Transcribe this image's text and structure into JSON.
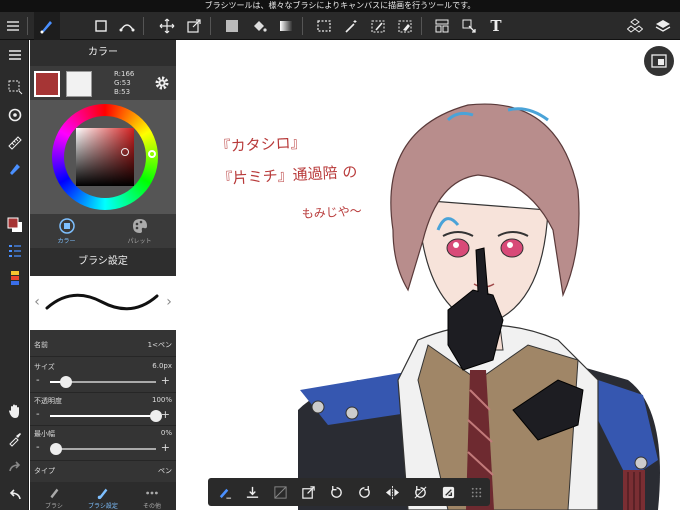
{
  "tipbar": {
    "text": "ブラシツールは、様々なブラシによりキャンバスに描画を行うツールです。"
  },
  "toolbar": {
    "icons": [
      "menu-icon",
      "brush-tool-icon",
      "shape-tool-icon",
      "curve-tool-icon",
      "move-tool-icon",
      "transform-tool-icon",
      "fill-color-icon",
      "bucket-icon",
      "gradient-icon",
      "select-rect-icon",
      "magic-wand-icon",
      "select-pen-icon",
      "select-eraser-icon",
      "layout-icon",
      "operation-icon",
      "text-tool-icon",
      "materials-icon",
      "layers-icon"
    ],
    "text_tool_label": "T"
  },
  "leftstrip": {
    "icons": [
      "layer-menu-icon",
      "selection-icon",
      "snap-icon",
      "ruler-icon",
      "eyedropper-pen-icon",
      "color-toggle-icon",
      "brush-list-icon",
      "palette-list-icon",
      "hand-icon",
      "dropper-icon",
      "redo-icon",
      "undo-icon"
    ]
  },
  "color_panel": {
    "title": "カラー",
    "main_color": "#a63535",
    "sub_color": "#f2f2f2",
    "r": "R:166",
    "g": "G:53",
    "b": "B:53",
    "tabs": [
      {
        "label": "カラー",
        "active": true
      },
      {
        "label": "パレット",
        "active": false
      }
    ]
  },
  "brush_panel": {
    "title": "ブラシ設定",
    "name_label": "名前",
    "name_value": "1<ペン",
    "size_label": "サイズ",
    "size_value": "6.0px",
    "size_level": 0.15,
    "opacity_label": "不透明度",
    "opacity_value": "100%",
    "opacity_level": 1.0,
    "min_width_label": "最小幅",
    "min_width_value": "0%",
    "min_width_level": 0.0,
    "type_label": "タイプ",
    "type_value": "ペン"
  },
  "bottom_tabs": [
    {
      "label": "ブラシ",
      "active": false
    },
    {
      "label": "ブラシ設定",
      "active": true
    },
    {
      "label": "その他",
      "active": false
    }
  ],
  "canvas": {
    "handwriting": [
      "『カタシロ』",
      "『片ミチ』通過陪 の",
      "もみじや〜"
    ]
  },
  "floatbar": {
    "icons": [
      "brush-fill-icon",
      "download-icon",
      "crop-clear-icon",
      "export-icon",
      "rotate-left-icon",
      "rotate-right-icon",
      "flip-horizontal-icon",
      "rotate-reset-icon",
      "filter-icon",
      "grid-icon"
    ]
  },
  "colors": {
    "accent": "#3d7eff",
    "panel": "#343434",
    "bar": "#2a2a2a"
  }
}
